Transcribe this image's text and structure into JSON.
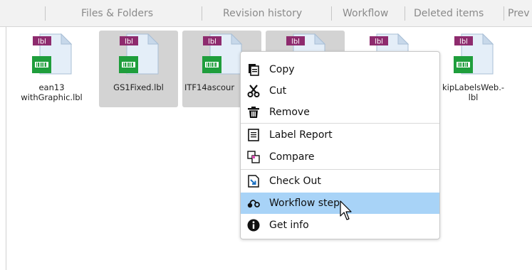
{
  "tabs": [
    {
      "label": "Files & Folders"
    },
    {
      "label": "Revision history"
    },
    {
      "label": "Workflow"
    },
    {
      "label": "Deleted items"
    },
    {
      "label": "Prev"
    }
  ],
  "files": [
    {
      "badge": "lbl",
      "line1": "ean13",
      "line2": "withGraphic.lbl",
      "selected": false
    },
    {
      "badge": "lbl",
      "line1": "GS1Fixed.lbl",
      "line2": "",
      "selected": true
    },
    {
      "badge": "lbl",
      "line1": "ITF14ascour",
      "line2": "",
      "selected": true
    },
    {
      "badge": "lbl",
      "line1": "",
      "line2": "",
      "selected": true
    },
    {
      "badge": "lbl",
      "line1": "",
      "line2": "",
      "selected": false
    },
    {
      "badge": "lbl",
      "line1": "kipLabelsWeb.-",
      "line2": "lbl",
      "selected": false
    }
  ],
  "context_menu": {
    "items": [
      {
        "label": "Copy",
        "icon": "copy-icon"
      },
      {
        "label": "Cut",
        "icon": "scissors-icon"
      },
      {
        "label": "Remove",
        "icon": "trash-icon"
      },
      {
        "label": "Label Report",
        "icon": "report-icon"
      },
      {
        "label": "Compare",
        "icon": "compare-icon"
      },
      {
        "label": "Check Out",
        "icon": "check-out-icon"
      },
      {
        "label": "Workflow step",
        "icon": "workflow-icon"
      },
      {
        "label": "Get info",
        "icon": "info-icon"
      }
    ],
    "highlighted": "Workflow step"
  },
  "colors": {
    "selected_file_bg": "#d3d3d3",
    "menu_hover_bg": "#a8d3f7",
    "badge_purple": "#8e2b6e",
    "barcode_green": "#1f9e3c"
  }
}
